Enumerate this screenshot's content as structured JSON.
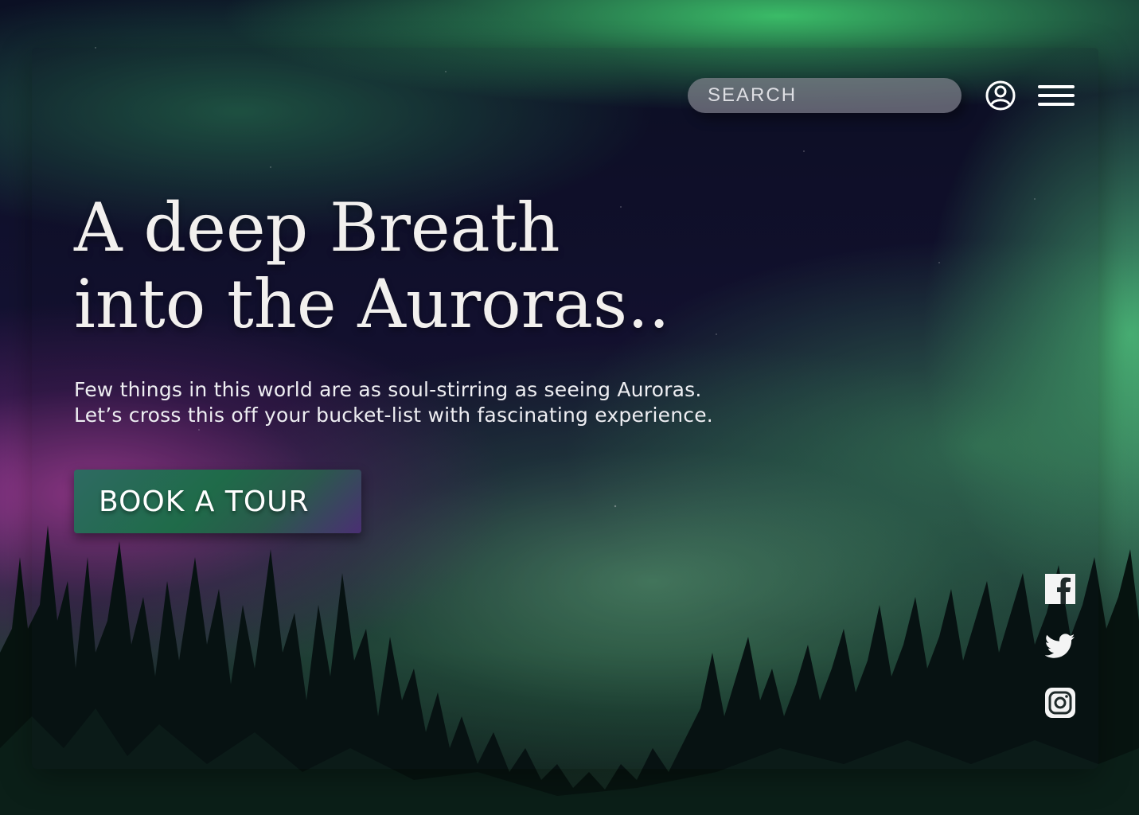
{
  "header": {
    "search": {
      "placeholder": "SEARCH"
    },
    "account_icon": "user-circle-icon",
    "menu_icon": "hamburger-menu-icon"
  },
  "hero": {
    "headline_line1": "A deep Breath",
    "headline_line2": "into the Auroras..",
    "subtitle_line1": "Few things in this world are as soul-stirring as seeing Auroras.",
    "subtitle_line2": "Let’s cross this off your bucket-list with fascinating experience.",
    "cta_label": "BOOK A TOUR"
  },
  "social": [
    {
      "icon": "facebook-icon"
    },
    {
      "icon": "twitter-icon"
    },
    {
      "icon": "instagram-icon"
    }
  ],
  "colors": {
    "text": "#f2f0ee",
    "cta_green": "#1f6b49",
    "cta_purple": "#4a2f73",
    "search_bg": "#8c8c96"
  }
}
